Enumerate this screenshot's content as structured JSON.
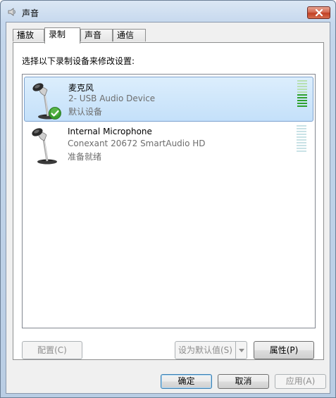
{
  "window": {
    "title": "声音",
    "icon": "speaker-icon",
    "close_icon": "close-icon"
  },
  "tabs": [
    {
      "label": "播放",
      "active": false
    },
    {
      "label": "录制",
      "active": true
    },
    {
      "label": "声音",
      "active": false
    },
    {
      "label": "通信",
      "active": false
    }
  ],
  "panel": {
    "instruction": "选择以下录制设备来修改设置:"
  },
  "devices": [
    {
      "name": "麦克风",
      "description": "2- USB Audio Device",
      "status": "默认设备",
      "icon": "microphone-icon",
      "badge_icon": "default-check-icon",
      "selected": true,
      "level_active_segments": 5,
      "level_total_segments": 10,
      "meter_active_color": "#2ea12e",
      "meter_idle_color": "#b7e0b2"
    },
    {
      "name": "Internal Microphone",
      "description": "Conexant 20672 SmartAudio HD",
      "status": "准备就绪",
      "icon": "microphone-icon",
      "selected": false,
      "level_active_segments": 0,
      "level_total_segments": 10,
      "meter_idle_color": "#c9e2e6"
    }
  ],
  "buttons": {
    "configure": "配置(C)",
    "set_default": "设为默认值(S)",
    "properties": "属性(P)",
    "ok": "确定",
    "cancel": "取消",
    "apply": "应用(A)"
  }
}
